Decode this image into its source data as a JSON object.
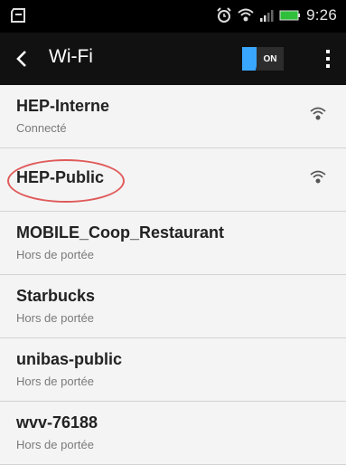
{
  "status": {
    "time": "9:26",
    "left_icon": "sd-card-icon",
    "icons": [
      "alarm-icon",
      "wifi-icon",
      "signal-icon",
      "battery-icon"
    ]
  },
  "appbar": {
    "title": "Wi-Fi",
    "toggle_label": "ON",
    "toggle_color": "#3aa7ff"
  },
  "networks": [
    {
      "name": "HEP-Interne",
      "status": "Connecté"
    },
    {
      "name": "HEP-Public",
      "status": ""
    },
    {
      "name": "MOBILE_Coop_Restaurant",
      "status": "Hors de portée"
    },
    {
      "name": "Starbucks",
      "status": "Hors de portée"
    },
    {
      "name": "unibas-public",
      "status": "Hors de portée"
    },
    {
      "name": "wvv-76188",
      "status": "Hors de portée"
    }
  ],
  "highlight_color": "#e05a5a"
}
